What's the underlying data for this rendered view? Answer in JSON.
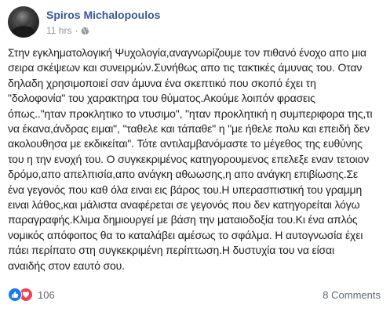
{
  "post": {
    "author": "Spiros Michalopoulos",
    "time": "11 hrs",
    "separator": "·",
    "privacy_icon": "globe-icon",
    "text": "Στην εγκληματολογική Ψυχολογία,αναγνωρίζουμε τον πιθανό ένοχο απο μια\nσειρα σκέψεων και συνειρμών.Συνήθως απο τις τακτικές άμυνας του. Οταν\nδηλαδη χρησιμοποιεί σαν άμυνα ένα σκεπτικό που σκοπό έχει τη\n\"δολοφονία\" του χαρακτηρα του θύματος.Ακούμε λοιπόν φρασεις\nόπως..\"ηταν προκλητικο το ντυσιμο\", \"ηταν προκλητική η συμπεριφορα της,τι\nνα έκανα,άνδρας ειμαι\", \"ταθελε και τάπαθε\" η \"με ήθελε πολυ και επειδή δεν\nακολουθησα με εκδικείται\". Τότε αντιλαμβανόμαστε το μέγεθος της ευθύνης\nτου η την ενοχή του. Ο συγκεκριμένος κατηγορουμενος επελεξε εναν τετοιον\nδρόμο,απο απελπισία,απο ανάγκη αθωωσης,η απο ανάγκη επιβίωσης.Σε\nένα γεγονός που καθ όλα ειναι εις βάρος του.Η υπερασπιστική του γραμμη\nειναι λάθος,και μάλιστα αναφέρεται σε γεγονός που δεν κατηγορείται λόγω\nπαραγραφής.Κλιμα δημιουργεί με βάση την ματαιοδοξία του.Κι ένα απλός\nνομικός απόφοιτος θα το καταλάβει αμέσως το σφάλμα. Η αυτογνωσία έχει\nπάει περίπατο στη συγκεκριμένη περίπτωση.Η δυστυχία του να είσαι\nαναιδής στον εαυτό σου."
  },
  "reactions": {
    "icons": [
      "like-icon",
      "love-icon"
    ],
    "count": "106",
    "like_color": "#1877f2",
    "love_color": "#f33e58"
  },
  "comments": {
    "label": "8 Comments"
  },
  "colors": {
    "author": "#385898",
    "meta": "#90949c",
    "text": "#1c1e21"
  }
}
